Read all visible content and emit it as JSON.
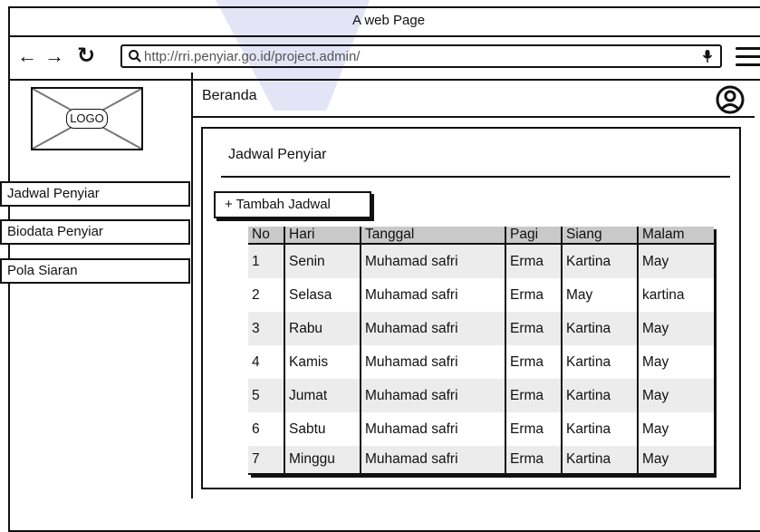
{
  "window": {
    "title": "A web Page"
  },
  "browser": {
    "back_icon": "←",
    "forward_icon": "→",
    "reload_icon": "↻",
    "url": "http://rri.penyiar.go.id/project.admin/"
  },
  "logo": {
    "label": "LOGO"
  },
  "sidebar": {
    "items": [
      {
        "label": "Jadwal Penyiar"
      },
      {
        "label": "Biodata Penyiar"
      },
      {
        "label": "Pola Siaran"
      }
    ]
  },
  "header": {
    "title": "Beranda"
  },
  "panel": {
    "title": "Jadwal Penyiar",
    "add_button": "+ Tambah Jadwal"
  },
  "table": {
    "columns": [
      "No",
      "Hari",
      "Tanggal",
      "Pagi",
      "Siang",
      "Malam"
    ],
    "rows": [
      [
        "1",
        "Senin",
        "Muhamad safri",
        "Erma",
        "Kartina",
        "May"
      ],
      [
        "2",
        "Selasa",
        "Muhamad safri",
        "Erma",
        "May",
        "kartina"
      ],
      [
        "3",
        "Rabu",
        "Muhamad safri",
        "Erma",
        "Kartina",
        "May"
      ],
      [
        "4",
        "Kamis",
        "Muhamad safri",
        "Erma",
        "Kartina",
        "May"
      ],
      [
        "5",
        "Jumat",
        "Muhamad safri",
        "Erma",
        "Kartina",
        "May"
      ],
      [
        "6",
        "Sabtu",
        "Muhamad safri",
        "Erma",
        "Kartina",
        "May"
      ],
      [
        "7",
        "Minggu",
        "Muhamad safri",
        "Erma",
        "Kartina",
        "May"
      ]
    ]
  }
}
